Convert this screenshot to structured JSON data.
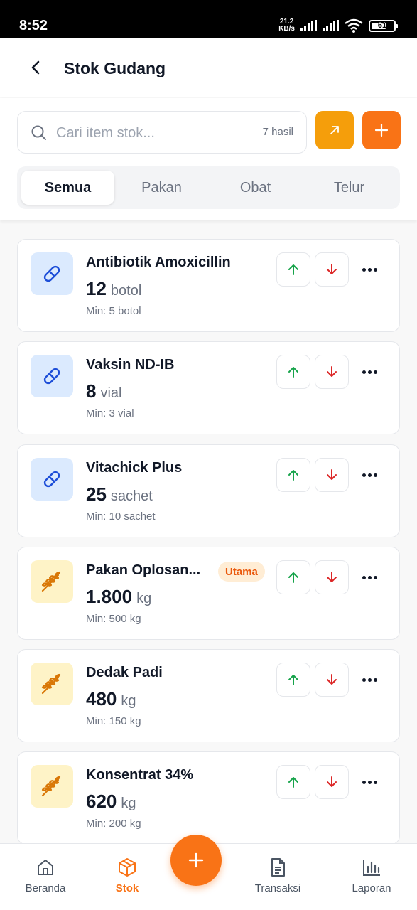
{
  "status_bar": {
    "time": "8:52",
    "net_speed_value": "21.2",
    "net_speed_unit": "KB/s",
    "battery": "61"
  },
  "header": {
    "title": "Stok Gudang",
    "back_icon": "chevron-left-icon"
  },
  "search": {
    "placeholder": "Cari item stok...",
    "value": "",
    "result_count": "7 hasil"
  },
  "actions": {
    "export_icon": "arrow-up-right-icon",
    "add_icon": "plus-icon"
  },
  "tabs": [
    {
      "label": "Semua",
      "active": true
    },
    {
      "label": "Pakan",
      "active": false
    },
    {
      "label": "Obat",
      "active": false
    },
    {
      "label": "Telur",
      "active": false
    }
  ],
  "items": [
    {
      "name": "Antibiotik Amoxicillin",
      "qty": "12",
      "unit": "botol",
      "min": "Min: 5 botol",
      "category": "obat",
      "icon": "pill-icon",
      "badge": ""
    },
    {
      "name": "Vaksin ND-IB",
      "qty": "8",
      "unit": "vial",
      "min": "Min: 3 vial",
      "category": "obat",
      "icon": "pill-icon",
      "badge": ""
    },
    {
      "name": "Vitachick Plus",
      "qty": "25",
      "unit": "sachet",
      "min": "Min: 10 sachet",
      "category": "obat",
      "icon": "pill-icon",
      "badge": ""
    },
    {
      "name": "Pakan Oplosan...",
      "qty": "1.800",
      "unit": "kg",
      "min": "Min: 500 kg",
      "category": "pakan",
      "icon": "wheat-icon",
      "badge": "Utama"
    },
    {
      "name": "Dedak Padi",
      "qty": "480",
      "unit": "kg",
      "min": "Min: 150 kg",
      "category": "pakan",
      "icon": "wheat-icon",
      "badge": ""
    },
    {
      "name": "Konsentrat 34%",
      "qty": "620",
      "unit": "kg",
      "min": "Min: 200 kg",
      "category": "pakan",
      "icon": "wheat-icon",
      "badge": ""
    }
  ],
  "bottom_nav": [
    {
      "label": "Beranda",
      "icon": "home-icon",
      "active": false
    },
    {
      "label": "Stok",
      "icon": "box-icon",
      "active": true
    },
    {
      "label": "Transaksi",
      "icon": "document-icon",
      "active": false
    },
    {
      "label": "Laporan",
      "icon": "bar-chart-icon",
      "active": false
    }
  ],
  "colors": {
    "accent": "#f97316",
    "export": "#f59e0b",
    "up": "#16a34a",
    "down": "#dc2626",
    "obat_bg": "#dbeafe",
    "obat_icon": "#1d4ed8",
    "pakan_bg": "#fef3c7",
    "pakan_icon": "#d97706"
  }
}
